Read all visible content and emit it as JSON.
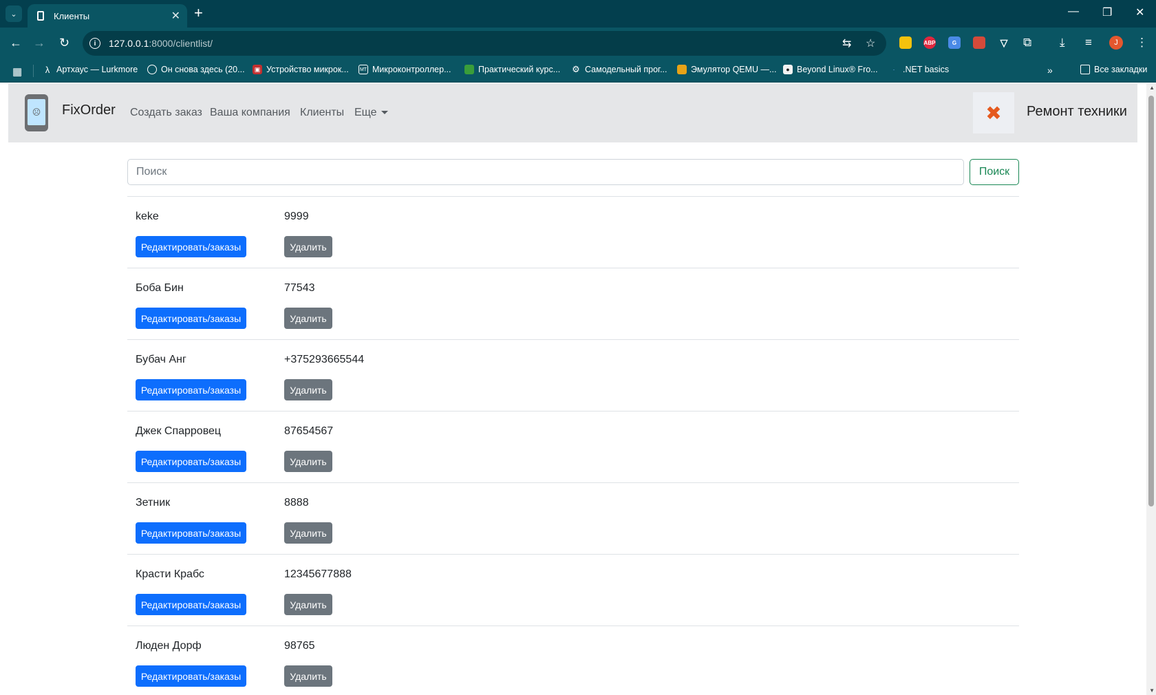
{
  "browser": {
    "tab_title": "Клиенты",
    "url_host": "127.0.0.1",
    "url_path": ":8000/clientlist/",
    "profile_initial": "J",
    "bookmarks": [
      {
        "label": "Артхаус — Lurkmore",
        "icon": "lambda-icon"
      },
      {
        "label": "Он снова здесь (20...",
        "icon": "globe-icon"
      },
      {
        "label": "Устройство микрок...",
        "icon": "chip-icon"
      },
      {
        "label": "Микроконтроллер...",
        "icon": "mt-icon"
      },
      {
        "label": "Практический курс...",
        "icon": "course-icon"
      },
      {
        "label": "Самодельный прог...",
        "icon": "gear-icon"
      },
      {
        "label": "Эмулятор QEMU —...",
        "icon": "qemu-icon"
      },
      {
        "label": "Beyond Linux® Fro...",
        "icon": "tux-icon"
      },
      {
        "label": ".NET basics",
        "icon": "dotnet-icon"
      }
    ],
    "all_bookmarks": "Все закладки"
  },
  "site": {
    "brand": "FixOrder",
    "nav": {
      "create_order": "Создать заказ",
      "company": "Ваша компания",
      "clients": "Клиенты",
      "more": "Еще"
    },
    "right_title": "Ремонт техники"
  },
  "search": {
    "placeholder": "Поиск",
    "button": "Поиск"
  },
  "clients": [
    {
      "name": "keke",
      "phone": "9999"
    },
    {
      "name": "Боба Бин",
      "phone": "77543"
    },
    {
      "name": "Бубач Анг",
      "phone": "+375293665544"
    },
    {
      "name": "Джек Спарровец",
      "phone": "87654567"
    },
    {
      "name": "Зетник",
      "phone": "8888"
    },
    {
      "name": "Красти Крабс",
      "phone": "12345677888"
    },
    {
      "name": "Люден Дорф",
      "phone": "98765"
    }
  ],
  "actions": {
    "edit": "Редактировать/заказы",
    "delete": "Удалить"
  },
  "colors": {
    "primary": "#0d6efd",
    "secondary": "#6c757d",
    "success": "#198754",
    "chrome": "#0a5563"
  }
}
